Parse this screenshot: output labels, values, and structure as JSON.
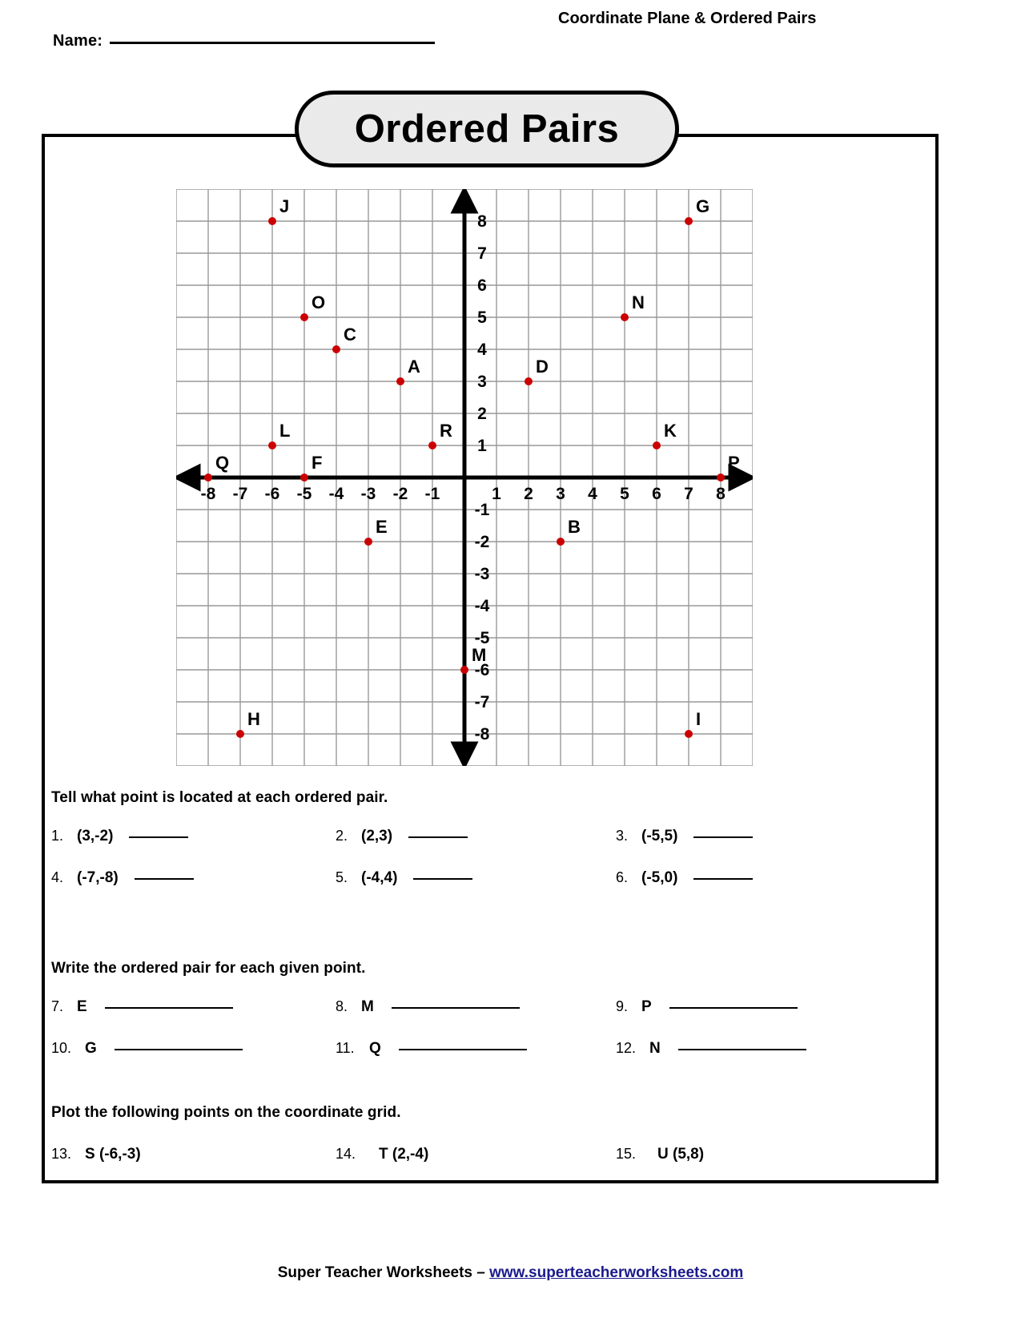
{
  "header": {
    "name_label": "Name:",
    "subject_title": "Coordinate Plane & Ordered Pairs"
  },
  "title": {
    "text": "Ordered Pairs"
  },
  "chart_data": {
    "type": "scatter",
    "title": "Ordered Pairs",
    "xlabel": "",
    "ylabel": "",
    "xlim": [
      -9,
      9
    ],
    "ylim": [
      -9,
      9
    ],
    "grid": true,
    "legend": false,
    "x_ticks": [
      -8,
      -7,
      -6,
      -5,
      -4,
      -3,
      -2,
      -1,
      1,
      2,
      3,
      4,
      5,
      6,
      7,
      8
    ],
    "y_ticks": [
      8,
      7,
      6,
      5,
      4,
      3,
      2,
      1,
      -1,
      -2,
      -3,
      -4,
      -5,
      -6,
      -7,
      -8
    ],
    "x_tick_labels": [
      "-8",
      "-7",
      "-6",
      "-5",
      "-4",
      "-3",
      "-2",
      "-1",
      "1",
      "2",
      "3",
      "4",
      "5",
      "6",
      "7",
      "8"
    ],
    "y_tick_labels": [
      "8",
      "7",
      "6",
      "5",
      "4",
      "3",
      "2",
      "1",
      "-1",
      "-2",
      "-3",
      "-4",
      "-5",
      "-6",
      "-7",
      "-8"
    ],
    "point_color": "#cc0000",
    "points": [
      {
        "label": "J",
        "x": -6,
        "y": 8
      },
      {
        "label": "G",
        "x": 7,
        "y": 8
      },
      {
        "label": "O",
        "x": -5,
        "y": 5
      },
      {
        "label": "N",
        "x": 5,
        "y": 5
      },
      {
        "label": "C",
        "x": -4,
        "y": 4
      },
      {
        "label": "A",
        "x": -2,
        "y": 3
      },
      {
        "label": "D",
        "x": 2,
        "y": 3
      },
      {
        "label": "L",
        "x": -6,
        "y": 1
      },
      {
        "label": "R",
        "x": -1,
        "y": 1
      },
      {
        "label": "K",
        "x": 6,
        "y": 1
      },
      {
        "label": "Q",
        "x": -8,
        "y": 0
      },
      {
        "label": "F",
        "x": -5,
        "y": 0
      },
      {
        "label": "P",
        "x": 8,
        "y": 0
      },
      {
        "label": "E",
        "x": -3,
        "y": -2
      },
      {
        "label": "B",
        "x": 3,
        "y": -2
      },
      {
        "label": "M",
        "x": 0,
        "y": -6
      },
      {
        "label": "H",
        "x": -7,
        "y": -8
      },
      {
        "label": "I",
        "x": 7,
        "y": -8
      }
    ]
  },
  "section1": {
    "heading": "Tell what point is located at each ordered pair.",
    "items": [
      {
        "num": "1.",
        "value": "(3,-2)"
      },
      {
        "num": "2.",
        "value": "(2,3)"
      },
      {
        "num": "3.",
        "value": "(-5,5)"
      },
      {
        "num": "4.",
        "value": "(-7,-8)"
      },
      {
        "num": "5.",
        "value": "(-4,4)"
      },
      {
        "num": "6.",
        "value": "(-5,0)"
      }
    ]
  },
  "section2": {
    "heading": "Write the ordered pair for each given point.",
    "items": [
      {
        "num": "7.",
        "value": "E"
      },
      {
        "num": "8.",
        "value": "M"
      },
      {
        "num": "9.",
        "value": "P"
      },
      {
        "num": "10.",
        "value": "G"
      },
      {
        "num": "11.",
        "value": "Q"
      },
      {
        "num": "12.",
        "value": "N"
      }
    ]
  },
  "section3": {
    "heading": "Plot the following points on the coordinate grid.",
    "items": [
      {
        "num": "13.",
        "value": "S  (-6,-3)"
      },
      {
        "num": "14.",
        "value": "T (2,-4)"
      },
      {
        "num": "15.",
        "value": "U (5,8)"
      }
    ]
  },
  "footer": {
    "brand": "Super Teacher Worksheets – ",
    "url": "www.superteacherworksheets.com"
  }
}
